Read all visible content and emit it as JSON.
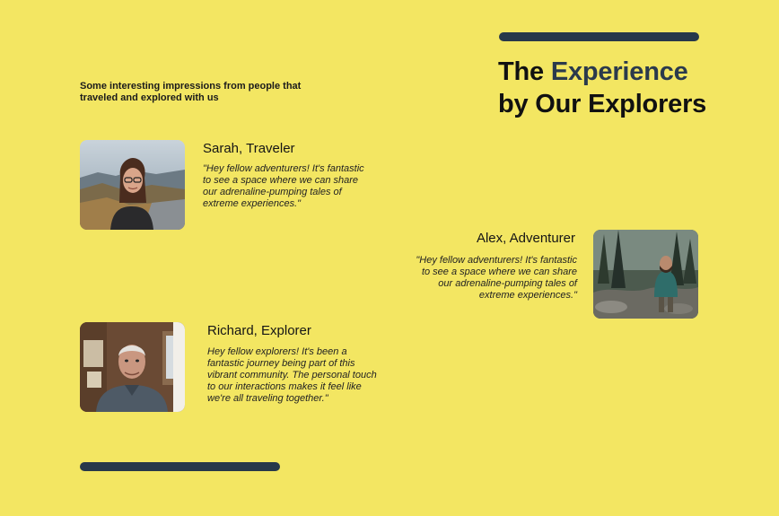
{
  "header": {
    "title_part1": "The ",
    "title_accent": "Experience",
    "title_line2": "by Our Explorers"
  },
  "intro": {
    "text": "Some interesting impressions from people that traveled and explored with us"
  },
  "testimonials": [
    {
      "name": "Sarah, Traveler",
      "quote": "\"Hey fellow adventurers! It's fantastic to see a space where we can share our adrenaline-pumping tales of extreme experiences.\""
    },
    {
      "name": "Alex, Adventurer",
      "quote": "\"Hey fellow adventurers! It's fantastic to see a space where we can share our adrenaline-pumping tales of extreme experiences.\""
    },
    {
      "name": "Richard, Explorer",
      "quote": "Hey fellow explorers! It's been a fantastic journey being part of this vibrant community. The personal touch to our interactions makes it feel like we're all traveling together.\""
    }
  ],
  "colors": {
    "background": "#f3e662",
    "accent": "#2b3a4c",
    "bar": "#27384a"
  }
}
